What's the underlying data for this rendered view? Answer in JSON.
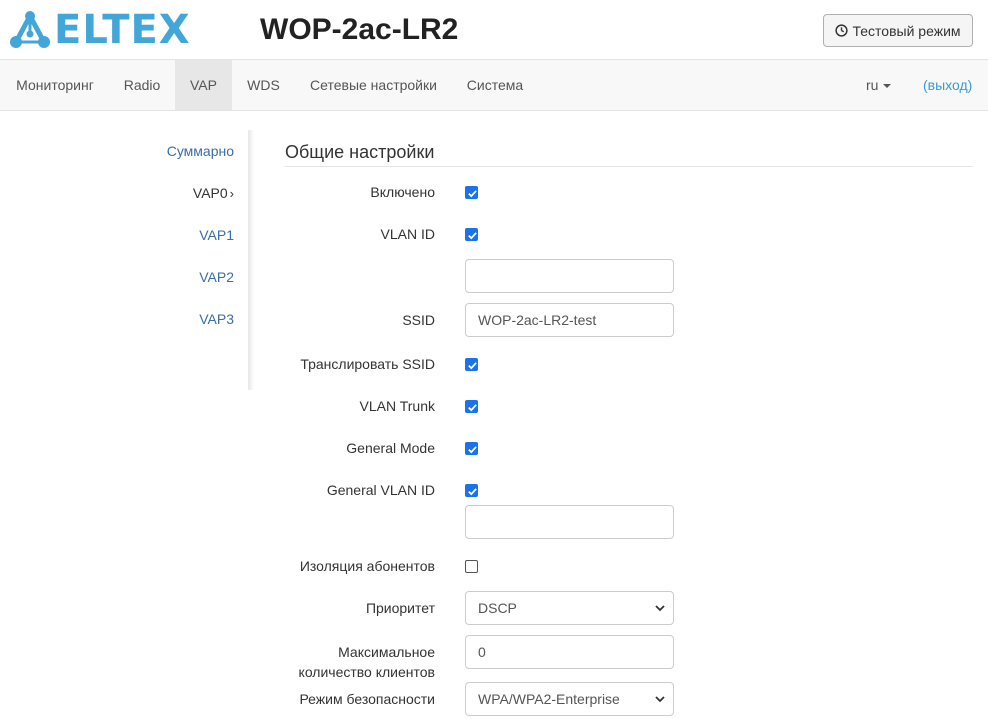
{
  "header": {
    "logo_text": "ELTEX",
    "device_title": "WOP-2ac-LR2",
    "test_mode_button": "Тестовый режим",
    "test_mode_icon": "clock-icon"
  },
  "nav": {
    "items": [
      {
        "label": "Мониторинг"
      },
      {
        "label": "Radio"
      },
      {
        "label": "VAP",
        "active": true
      },
      {
        "label": "WDS"
      },
      {
        "label": "Сетевые настройки"
      },
      {
        "label": "Система"
      }
    ],
    "lang": "ru",
    "exit": "(выход)"
  },
  "sidebar": {
    "items": [
      {
        "label": "Суммарно"
      },
      {
        "label": "VAP0",
        "current": true
      },
      {
        "label": "VAP1"
      },
      {
        "label": "VAP2"
      },
      {
        "label": "VAP3"
      }
    ],
    "current_chevron": "›"
  },
  "form": {
    "section_title": "Общие настройки",
    "enabled": {
      "label": "Включено",
      "checked": true
    },
    "vlan_id": {
      "label": "VLAN ID",
      "checked": true,
      "value": ""
    },
    "ssid": {
      "label": "SSID",
      "value": "WOP-2ac-LR2-test"
    },
    "broadcast_ssid": {
      "label": "Транслировать SSID",
      "checked": true
    },
    "vlan_trunk": {
      "label": "VLAN Trunk",
      "checked": true
    },
    "general_mode": {
      "label": "General Mode",
      "checked": true
    },
    "general_vlan_id": {
      "label": "General VLAN ID",
      "checked": true,
      "value": ""
    },
    "isolation": {
      "label": "Изоляция абонентов",
      "checked": false
    },
    "priority": {
      "label": "Приоритет",
      "value": "DSCP"
    },
    "max_clients": {
      "label_line1": "Максимальное",
      "label_line2": "количество клиентов",
      "value": "0"
    },
    "security_mode": {
      "label": "Режим безопасности",
      "value": "WPA/WPA2-Enterprise"
    }
  },
  "colors": {
    "brand": "#43a6d8",
    "link": "#3a6ea5",
    "checkbox": "#1a73e8"
  }
}
